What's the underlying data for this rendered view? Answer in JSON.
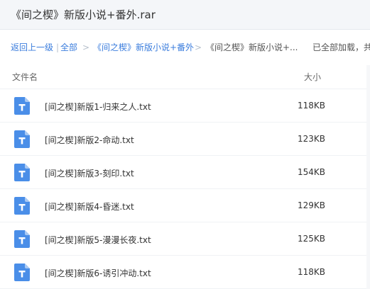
{
  "window": {
    "title": "《间之楔》新版小说+番外.rar"
  },
  "breadcrumb": {
    "back": "返回上一级",
    "sep_bar": "|",
    "all": "全部",
    "sep1": ">",
    "folder": "《间之楔》新版小说+番外",
    "sep2": ">",
    "current": "《间之楔》新版小说+...",
    "status": "已全部加载，共"
  },
  "table": {
    "headers": {
      "name": "文件名",
      "size": "大小"
    },
    "icon_name": "text-file-icon",
    "icon_color": "#4a8ee8",
    "rows": [
      {
        "name": "[间之楔]新版1-归来之人.txt",
        "size": "118KB"
      },
      {
        "name": "[间之楔]新版2-命动.txt",
        "size": "123KB"
      },
      {
        "name": "[间之楔]新版3-刻印.txt",
        "size": "154KB"
      },
      {
        "name": "[间之楔]新版4-昏迷.txt",
        "size": "129KB"
      },
      {
        "name": "[间之楔]新版5-漫漫长夜.txt",
        "size": "125KB"
      },
      {
        "name": "[间之楔]新版6-诱引冲动.txt",
        "size": "118KB"
      }
    ]
  }
}
